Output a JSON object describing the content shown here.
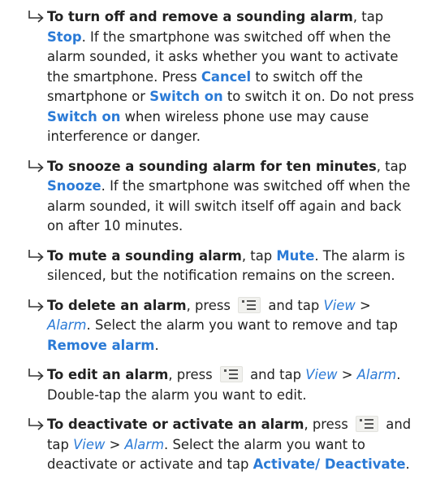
{
  "items": [
    {
      "parts": [
        {
          "t": "To turn off and remove a sounding alarm",
          "s": "b"
        },
        {
          "t": ", tap ",
          "s": ""
        },
        {
          "t": "Stop",
          "s": "kw"
        },
        {
          "t": ". If the smartphone was switched off when the alarm sounded, it asks whether you want to activate the smartphone. Press ",
          "s": ""
        },
        {
          "t": "Cancel",
          "s": "kw"
        },
        {
          "t": " to switch off the smartphone or ",
          "s": ""
        },
        {
          "t": "Switch on",
          "s": "kw"
        },
        {
          "t": " to switch it on. Do not press ",
          "s": ""
        },
        {
          "t": "Switch on",
          "s": "kw"
        },
        {
          "t": " when wireless phone use may cause interference or danger.",
          "s": ""
        }
      ]
    },
    {
      "parts": [
        {
          "t": "To snooze a sounding alarm for ten minutes",
          "s": "b"
        },
        {
          "t": ", tap ",
          "s": ""
        },
        {
          "t": "Snooze",
          "s": "kw"
        },
        {
          "t": ". If the smartphone was switched off when the alarm sounded, it will switch itself off again and back on after 10 minutes.",
          "s": ""
        }
      ]
    },
    {
      "parts": [
        {
          "t": "To mute a sounding alarm",
          "s": "b"
        },
        {
          "t": ", tap ",
          "s": ""
        },
        {
          "t": "Mute",
          "s": "kw"
        },
        {
          "t": ". The alarm is silenced, but the notification remains on the screen.",
          "s": ""
        }
      ]
    },
    {
      "parts": [
        {
          "t": "To delete an alarm",
          "s": "b"
        },
        {
          "t": ", press ",
          "s": ""
        },
        {
          "t": "menu-key-icon",
          "s": "icon"
        },
        {
          "t": " and tap ",
          "s": ""
        },
        {
          "t": "View",
          "s": "it"
        },
        {
          "t": " > ",
          "s": ""
        },
        {
          "t": "Alarm",
          "s": "it"
        },
        {
          "t": ". Select the alarm you want to remove and tap ",
          "s": ""
        },
        {
          "t": "Remove alarm",
          "s": "kw"
        },
        {
          "t": ".",
          "s": ""
        }
      ]
    },
    {
      "parts": [
        {
          "t": "To edit an alarm",
          "s": "b"
        },
        {
          "t": ", press ",
          "s": ""
        },
        {
          "t": "menu-key-icon",
          "s": "icon"
        },
        {
          "t": " and tap ",
          "s": ""
        },
        {
          "t": "View",
          "s": "it"
        },
        {
          "t": " > ",
          "s": ""
        },
        {
          "t": "Alarm",
          "s": "it"
        },
        {
          "t": ". Double-tap the alarm you want to edit.",
          "s": ""
        }
      ]
    },
    {
      "parts": [
        {
          "t": "To deactivate or activate an alarm",
          "s": "b"
        },
        {
          "t": ", press ",
          "s": ""
        },
        {
          "t": "menu-key-icon",
          "s": "icon"
        },
        {
          "t": " and tap ",
          "s": ""
        },
        {
          "t": "View",
          "s": "it"
        },
        {
          "t": " > ",
          "s": ""
        },
        {
          "t": "Alarm",
          "s": "it"
        },
        {
          "t": ". Select the alarm you want to deactivate or activate and tap ",
          "s": ""
        },
        {
          "t": "Activate/ Deactivate",
          "s": "kw"
        },
        {
          "t": ".",
          "s": ""
        }
      ]
    }
  ],
  "colors": {
    "accent": "#2a7ad6",
    "text": "#222222",
    "icon_bg": "#f1f1ee"
  }
}
